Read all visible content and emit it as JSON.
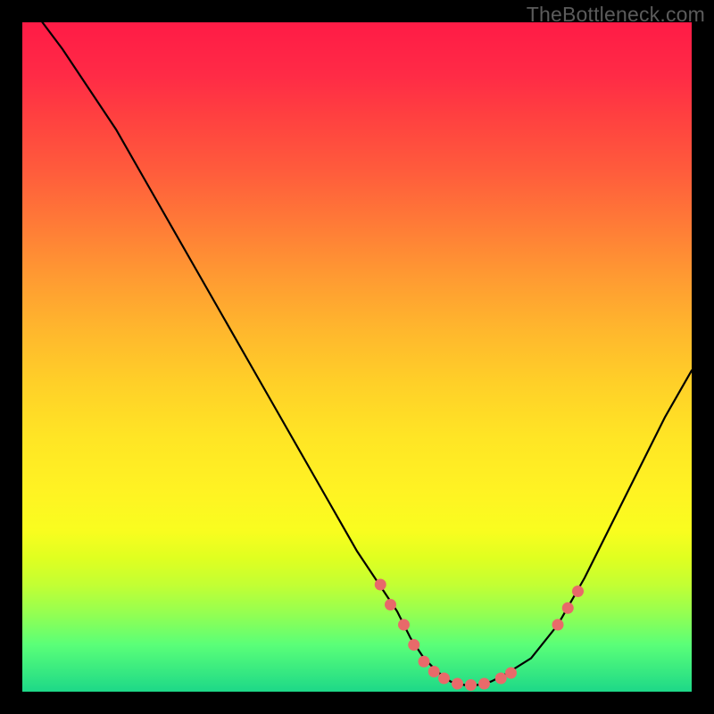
{
  "watermark": "TheBottleneck.com",
  "colors": {
    "frame": "#000000",
    "curve": "#000000",
    "marker_fill": "#e86a6a",
    "marker_stroke": "#c44a4a",
    "gradient_top": "#ff1b46",
    "gradient_bottom": "#1dd888"
  },
  "chart_data": {
    "type": "line",
    "title": "",
    "xlabel": "",
    "ylabel": "",
    "xlim": [
      0,
      100
    ],
    "ylim": [
      0,
      100
    ],
    "grid": false,
    "series": [
      {
        "name": "curve",
        "x": [
          3,
          6,
          10,
          14,
          18,
          22,
          26,
          30,
          34,
          38,
          42,
          46,
          50,
          52,
          54,
          56,
          58,
          60,
          62,
          64,
          66,
          68,
          70,
          72,
          76,
          80,
          84,
          88,
          92,
          96,
          100
        ],
        "y": [
          100,
          96,
          90,
          84,
          77,
          70,
          63,
          56,
          49,
          42,
          35,
          28,
          21,
          18,
          15,
          12,
          8,
          5,
          3,
          1.5,
          1,
          1,
          1.5,
          2.5,
          5,
          10,
          17,
          25,
          33,
          41,
          48
        ]
      }
    ],
    "markers": {
      "name": "highlighted-points",
      "x": [
        53.5,
        55,
        57,
        58.5,
        60,
        61.5,
        63,
        65,
        67,
        69,
        71.5,
        73,
        80,
        81.5,
        83
      ],
      "y": [
        16,
        13,
        10,
        7,
        4.5,
        3,
        2,
        1.2,
        1,
        1.2,
        2,
        2.8,
        10,
        12.5,
        15
      ]
    }
  }
}
